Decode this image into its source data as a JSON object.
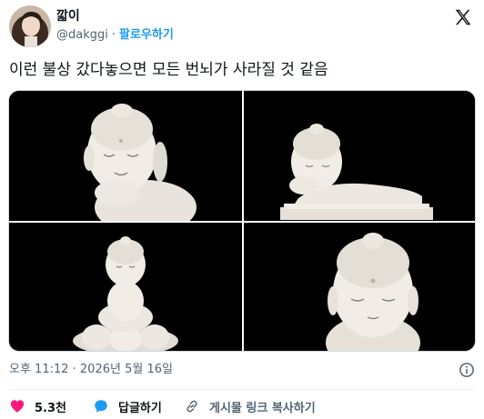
{
  "author": {
    "display_name": "깗이",
    "handle": "@dakggi",
    "follow_label": "팔로우하기",
    "avatar_icon": "avatar-photo"
  },
  "tweet": {
    "text": "이런 불상 갔다놓으면 모든 번뇌가 사라질 것 같음",
    "timestamp": "오후 11:12 · 2026년 5월 16일"
  },
  "media": {
    "images": [
      {
        "name": "buddha-figurine-resting-cheek"
      },
      {
        "name": "reclining-buddha-figurine"
      },
      {
        "name": "buddha-figurine-lotus-seat"
      },
      {
        "name": "buddha-figurine-closeup"
      }
    ]
  },
  "actions": {
    "like_count": "5.3천",
    "reply_label": "답글하기",
    "copy_link_label": "게시물 링크 복사하기"
  },
  "colors": {
    "accent": "#1d9bf0",
    "like": "#f91880",
    "secondary_text": "#536471"
  }
}
